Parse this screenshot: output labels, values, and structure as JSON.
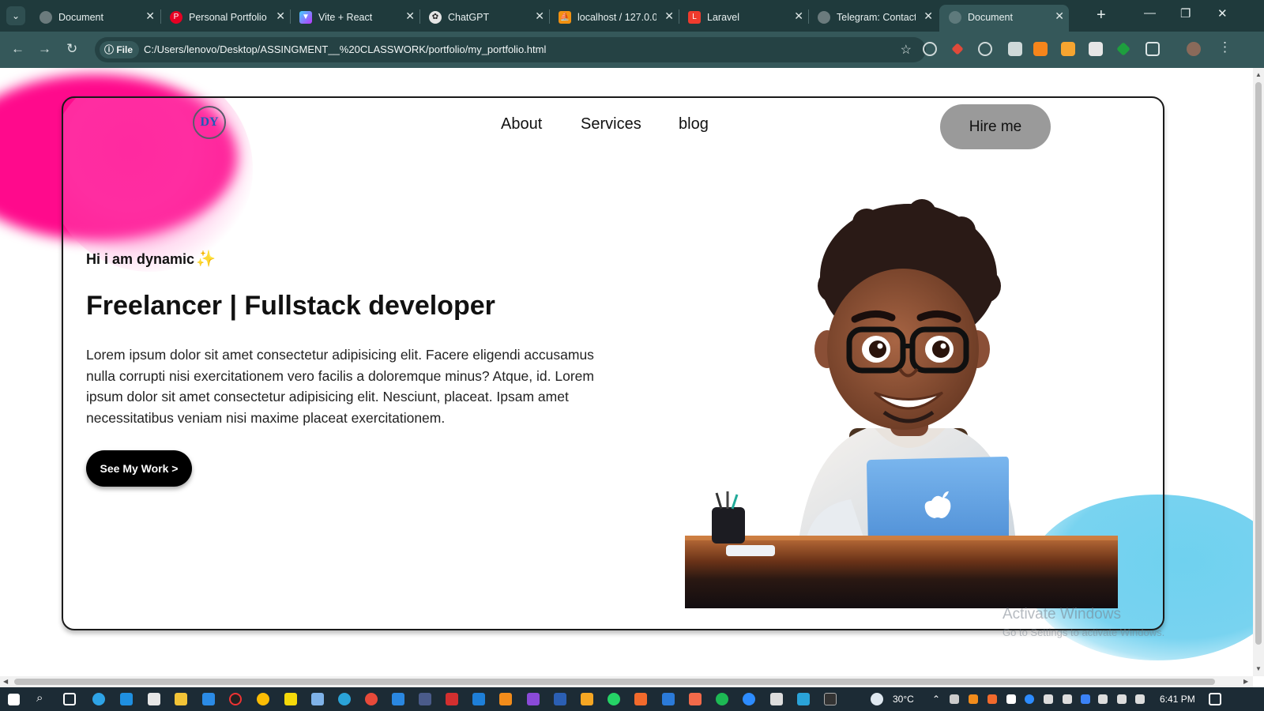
{
  "browser": {
    "tabs": [
      {
        "title": "Document",
        "icon": "globe-icon",
        "color": "#6b7b7d"
      },
      {
        "title": "Personal Portfolio",
        "icon": "pinterest-icon",
        "color": "#e60023"
      },
      {
        "title": "Vite + React",
        "icon": "vite-icon",
        "color": "#a855f7"
      },
      {
        "title": "ChatGPT",
        "icon": "chatgpt-icon",
        "color": "#e5e5e5"
      },
      {
        "title": "localhost / 127.0.0",
        "icon": "phpmyadmin-icon",
        "color": "#f29111"
      },
      {
        "title": "Laravel",
        "icon": "laravel-icon",
        "color": "#ef3b2d"
      },
      {
        "title": "Telegram: Contact",
        "icon": "globe-icon",
        "color": "#6b7b7d"
      },
      {
        "title": "Document",
        "icon": "globe-icon",
        "color": "#6b7b7d"
      }
    ],
    "active_tab": 7,
    "address": {
      "scheme_label": "File",
      "url": "C:/Users/lenovo/Desktop/ASSINGMENT__%20CLASSWORK/portfolio/my_portfolio.html"
    }
  },
  "page": {
    "logo_text": "DY",
    "nav": [
      {
        "label": "About"
      },
      {
        "label": "Services"
      },
      {
        "label": "blog"
      }
    ],
    "hire_label": "Hire me",
    "greeting": "Hi i am dynamic",
    "headline": "Freelancer | Fullstack developer",
    "bio": "Lorem ipsum dolor sit amet consectetur adipisicing elit. Facere eligendi accusamus nulla corrupti nisi exercitationem vero facilis a doloremque minus? Atque, id. Lorem ipsum dolor sit amet consectetur adipisicing elit. Nesciunt, placeat. Ipsam amet necessitatibus veniam nisi maxime placeat exercitationem.",
    "cta_label": "See My Work >",
    "colors": {
      "pink": "#ff0a8c",
      "blue": "#6fd1ef",
      "hire_bg": "#9a9a9a",
      "cta_bg": "#000000"
    }
  },
  "overlay": {
    "activate_title": "Activate Windows",
    "activate_sub": "Go to Settings to activate Windows."
  },
  "taskbar": {
    "weather": "30°C",
    "time": "6:41 PM"
  }
}
